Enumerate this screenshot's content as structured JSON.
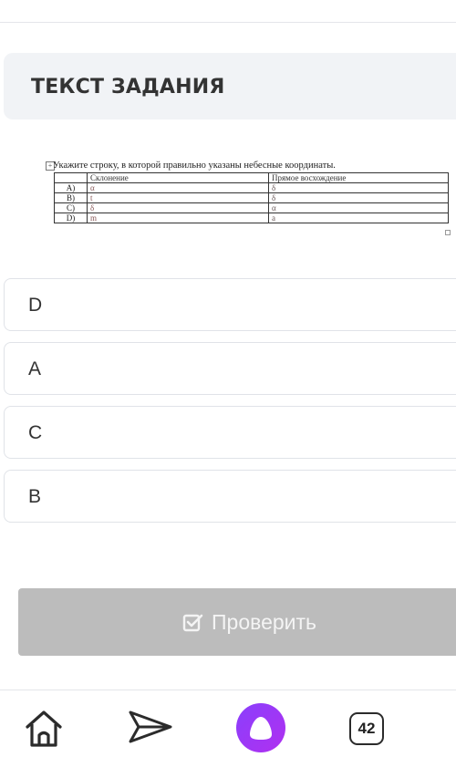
{
  "header": {
    "title": "ТЕКСТ ЗАДАНИЯ"
  },
  "task": {
    "question": "Укажите строку, в которой правильно указаны небесные координаты.",
    "columns": [
      "Склонение",
      "Прямое восхождение"
    ],
    "rows": [
      {
        "label": "A)",
        "c1": "α",
        "c2": "δ"
      },
      {
        "label": "B)",
        "c1": "t",
        "c2": "δ"
      },
      {
        "label": "C)",
        "c1": "δ",
        "c2": "α"
      },
      {
        "label": "D)",
        "c1": "m",
        "c2": "a"
      }
    ]
  },
  "options": [
    "D",
    "A",
    "C",
    "B"
  ],
  "check_button": {
    "label": "Проверить"
  },
  "nav": {
    "badge_count": "42"
  },
  "colors": {
    "button_bg": "#bcbcbc",
    "card_bg": "#f1f3f6",
    "assistant_accent": "#9b35f7"
  }
}
